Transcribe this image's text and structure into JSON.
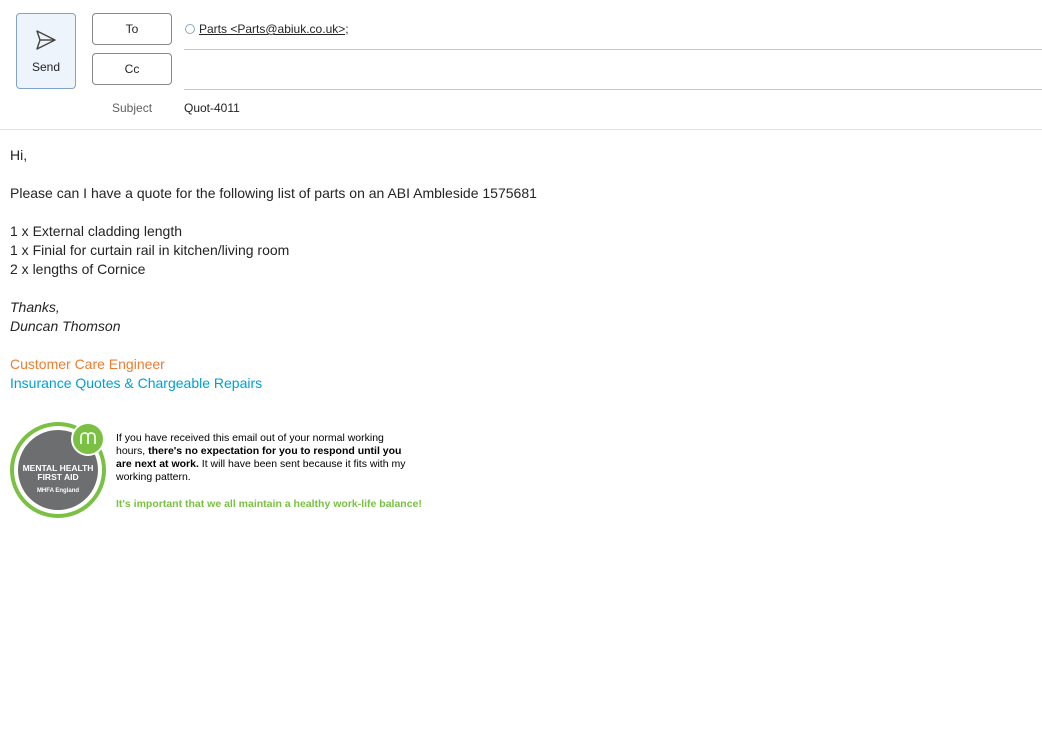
{
  "compose": {
    "send_label": "Send",
    "to_label": "To",
    "cc_label": "Cc",
    "to_recipient": "Parts <Parts@abiuk.co.uk>;",
    "cc_value": "",
    "subject_label": "Subject",
    "subject_value": "Quot-4011"
  },
  "body": {
    "greeting": "Hi,",
    "request": "Please can I have a quote for the following list of parts on an ABI Ambleside 1575681",
    "items": [
      "1 x External cladding length",
      "1 x Finial for curtain rail in kitchen/living room",
      "2 x lengths of Cornice"
    ],
    "signoff": "Thanks,",
    "sender_name": "Duncan Thomson",
    "job_title": "Customer Care Engineer",
    "department": "Insurance Quotes & Chargeable Repairs"
  },
  "signature": {
    "badge_line1": "MENTAL HEALTH",
    "badge_line2": "FIRST AID",
    "badge_line3": "MHFA England",
    "notice_part1": "If you have received this email out of your normal working hours, ",
    "notice_bold": "there's no expectation for you to respond until you are next at work.",
    "notice_part2": " It will have been sent because it fits with my working pattern.",
    "wellbeing": "It's important that we all maintain a healthy work-life balance!"
  },
  "colors": {
    "accent_orange": "#ed7d31",
    "accent_blue": "#00a0d6",
    "mhfa_green": "#7ac143",
    "mhfa_grey": "#6d6e70"
  },
  "icons": {
    "send": "send-icon",
    "recipient_status": "presence-status-icon",
    "mhfa_logo": "mhfa-logo-icon"
  }
}
